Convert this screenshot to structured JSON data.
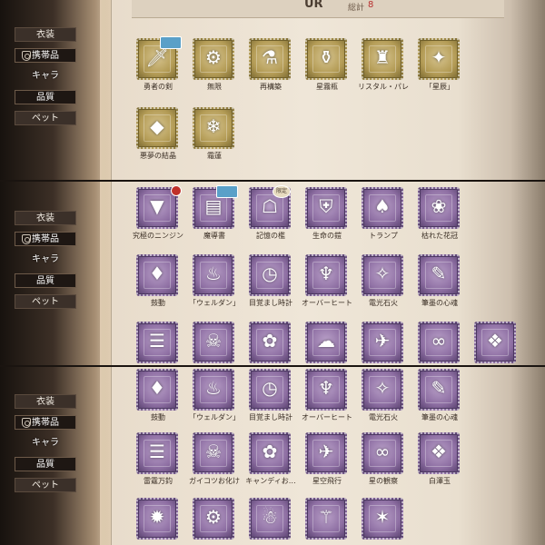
{
  "colors": {
    "gold_frame": "#b49c56",
    "purple_frame": "#8e6fa3",
    "menu_selected": "#1e1713",
    "total_red": "#b83030"
  },
  "menu": {
    "costume": "衣装",
    "item": "携帯品",
    "chara": "キャラ",
    "quality": "品質",
    "pet": "ペット"
  },
  "panel1": {
    "rarity": "UR",
    "total_label": "総計",
    "total_value": "8",
    "items": [
      {
        "name": "勇者の剣",
        "icon": "sword-icon",
        "badge": "collab"
      },
      {
        "name": "無限",
        "icon": "cannon-icon"
      },
      {
        "name": "再構築",
        "icon": "device-icon"
      },
      {
        "name": "星霧瓶",
        "icon": "bottle-icon"
      },
      {
        "name": "リスタル・パレ",
        "icon": "crystal-palace-icon"
      },
      {
        "name": "「星辰」",
        "icon": "star-icon"
      },
      {
        "name": "悪夢の結晶",
        "icon": "crystal-icon"
      },
      {
        "name": "霜蓮",
        "icon": "frost-lotus-icon"
      }
    ]
  },
  "panel2": {
    "row1": [
      {
        "name": "究極のニンジン",
        "icon": "carrot-icon",
        "badge": "red"
      },
      {
        "name": "魔導書",
        "icon": "book-icon",
        "badge": "collab"
      },
      {
        "name": "記憶の檻",
        "icon": "cage-icon",
        "badge": "limited",
        "badge_text": "限定"
      },
      {
        "name": "生命の鎧",
        "icon": "armor-icon"
      },
      {
        "name": "トランプ",
        "icon": "cards-icon"
      },
      {
        "name": "枯れた花冠",
        "icon": "wreath-icon"
      }
    ],
    "row2": [
      {
        "name": "鼓動",
        "icon": "heart-gem-icon"
      },
      {
        "name": "「ウェルダン」",
        "icon": "grill-icon"
      },
      {
        "name": "目覚まし時計",
        "icon": "clock-icon"
      },
      {
        "name": "オーバーヒート",
        "icon": "torch-icon"
      },
      {
        "name": "電光石火",
        "icon": "lightning-gem-icon"
      },
      {
        "name": "筆墨の心魂",
        "icon": "brush-icon"
      }
    ],
    "row3": [
      {
        "name": "",
        "icon": "scroll-icon"
      },
      {
        "name": "",
        "icon": "skull-icon"
      },
      {
        "name": "",
        "icon": "candy-icon"
      },
      {
        "name": "",
        "icon": "ghost-icon"
      },
      {
        "name": "",
        "icon": "starship-icon"
      },
      {
        "name": "",
        "icon": "glasses-icon"
      },
      {
        "name": "",
        "icon": "jade-icon"
      }
    ]
  },
  "panel3": {
    "row1": [
      {
        "name": "鼓動",
        "icon": "heart-gem-icon"
      },
      {
        "name": "「ウェルダン」",
        "icon": "grill-icon"
      },
      {
        "name": "目覚まし時計",
        "icon": "clock-icon"
      },
      {
        "name": "オーバーヒート",
        "icon": "torch-icon"
      },
      {
        "name": "電光石火",
        "icon": "lightning-gem-icon"
      },
      {
        "name": "筆墨の心魂",
        "icon": "brush-icon"
      }
    ],
    "row2": [
      {
        "name": "雷霆万鈞",
        "icon": "scroll-icon"
      },
      {
        "name": "ガイコツお化け",
        "icon": "skull-icon"
      },
      {
        "name": "キャンディお…",
        "icon": "candy-icon"
      },
      {
        "name": "星空飛行",
        "icon": "starship-icon"
      },
      {
        "name": "星の観察",
        "icon": "glasses-icon"
      },
      {
        "name": "白澤玉",
        "icon": "jade-icon"
      }
    ],
    "row3": [
      {
        "name": "",
        "icon": "beetle-icon"
      },
      {
        "name": "",
        "icon": "gear-icon"
      },
      {
        "name": "",
        "icon": "snowman-icon"
      },
      {
        "name": "",
        "icon": "staff-icon"
      },
      {
        "name": "",
        "icon": "wand-icon"
      }
    ]
  }
}
